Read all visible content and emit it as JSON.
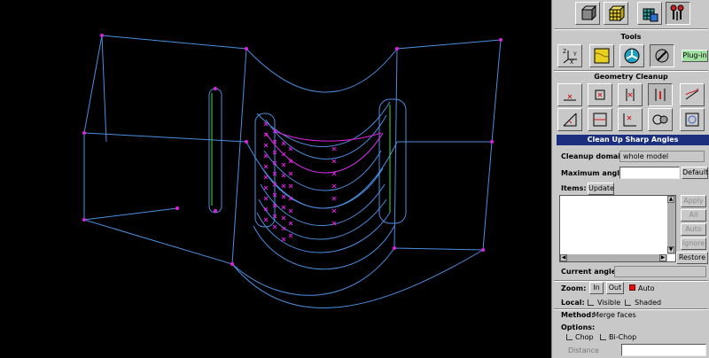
{
  "toolbar_top": {
    "icons": [
      "geometry-icon",
      "mesh-icon",
      "zones-icon",
      "operations-icon"
    ]
  },
  "tools": {
    "title": "Tools",
    "plugin_label": "Plug-in",
    "axes_icon_text": "Z Y X"
  },
  "geometry_cleanup": {
    "title": "Geometry Cleanup"
  },
  "form": {
    "title": "Clean Up Sharp Angles",
    "cleanup_domain_label": "Cleanup domain",
    "cleanup_domain_value": "whole model",
    "max_angle_label": "Maximum angle",
    "max_angle_value": "",
    "default_button": "Default",
    "items_label": "Items:",
    "update_button": "Update",
    "apply_button": "Apply",
    "all_button": "All",
    "auto_button": "Auto",
    "ignore_button": "Ignore",
    "restore_button": "Restore",
    "current_angle_label": "Current angle",
    "current_angle_value": "",
    "zoom_label": "Zoom:",
    "zoom_in_button": "In",
    "zoom_out_button": "Out",
    "zoom_auto_label": "Auto",
    "zoom_auto_checked": true,
    "local_label": "Local:",
    "visible_label": "Visible",
    "shaded_label": "Shaded",
    "method_label": "Method:",
    "method_value": "Merge faces",
    "options_label": "Options:",
    "chop_label": "Chop",
    "bichop_label": "Bi-Chop",
    "distance_label": "Distance",
    "distance_value": ""
  },
  "colors": {
    "wire": "#4a8fe0",
    "vertex": "#e020e0",
    "highlight": "#40e040",
    "title_bar": "#1c2f7e",
    "panel_bg": "#c8c8c8"
  }
}
